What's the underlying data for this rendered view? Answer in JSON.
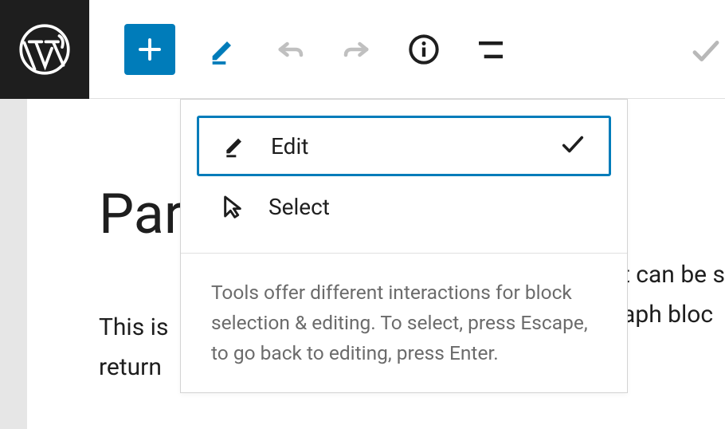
{
  "toolbar": {
    "add_icon": "plus",
    "mode_icon": "pencil",
    "undo_icon": "undo",
    "redo_icon": "redo",
    "info_icon": "info",
    "outline_icon": "outline",
    "save_icon": "check"
  },
  "content": {
    "title": "Para",
    "paragraph_line1": "This is",
    "paragraph_line2": "return",
    "paragraph_right1": "t can be s",
    "paragraph_right2": "aph bloc"
  },
  "dropdown": {
    "items": [
      {
        "label": "Edit",
        "icon": "pencil",
        "selected": true
      },
      {
        "label": "Select",
        "icon": "cursor",
        "selected": false
      }
    ],
    "help_text": "Tools offer different interactions for block selection & editing. To select, press Escape, to go back to editing, press Enter."
  }
}
